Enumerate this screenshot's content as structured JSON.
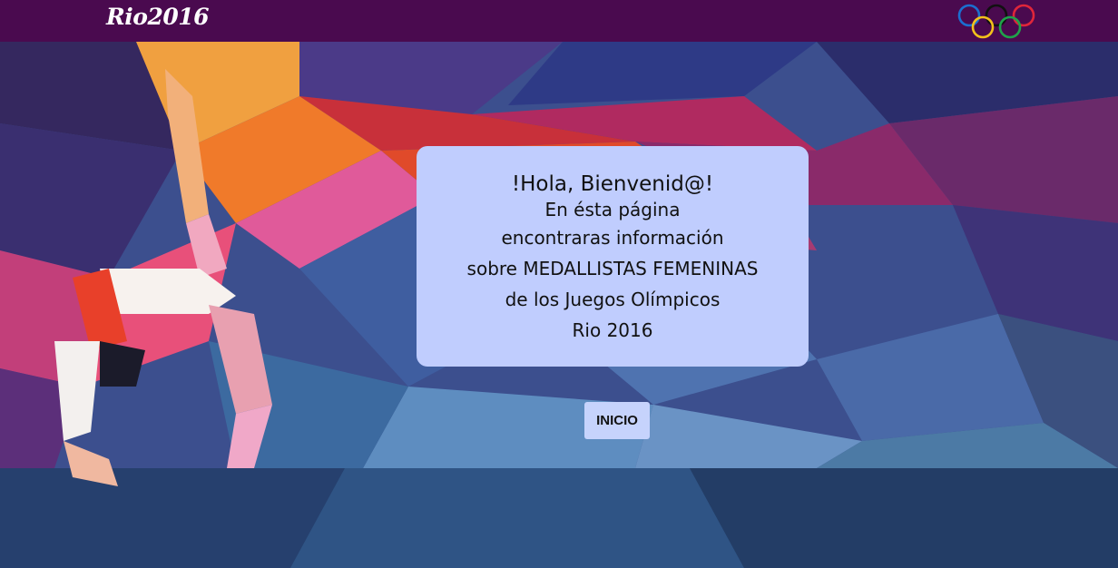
{
  "header": {
    "logo_text": "Rio2016",
    "background_color": "#4a0a4f",
    "rings_icon": "olympic-rings-icon"
  },
  "welcome_card": {
    "title": "!Hola, Bienvenid@!",
    "lines": [
      "En ésta página",
      "encontraras información",
      "sobre MEDALLISTAS FEMENINAS",
      "de los Juegos Olímpicos",
      "Rio 2016"
    ],
    "background_color": "#c0cdfe"
  },
  "actions": {
    "inicio_label": "INICIO"
  },
  "hero": {
    "image": "gymnast-polygon-illustration"
  }
}
